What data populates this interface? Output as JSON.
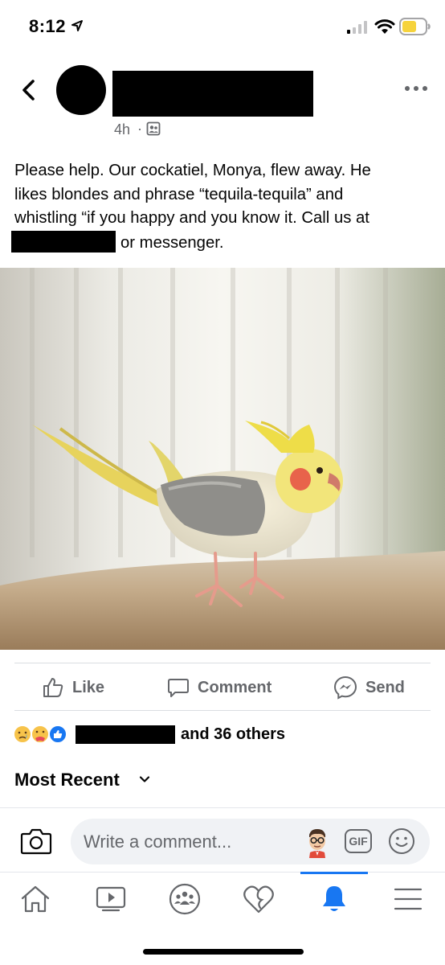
{
  "status_bar": {
    "time": "8:12"
  },
  "post": {
    "time_ago": "4h",
    "separator": "·",
    "text_lines": [
      "Please help. Our cockatiel, Monya, flew away. He",
      "likes blondes and phrase “tequila-tequila” and",
      "whistling “if you happy and you know it. Call us at"
    ],
    "text_last_line_suffix": "or messenger."
  },
  "actions": {
    "like": "Like",
    "comment": "Comment",
    "send": "Send"
  },
  "reactions": {
    "others_text": "and 36 others"
  },
  "comments": {
    "sort_label": "Most Recent",
    "composer_placeholder": "Write a comment...",
    "gif_label": "GIF"
  },
  "colors": {
    "brand_blue": "#1877f2",
    "secondary_text": "#65676b",
    "divider": "#dadde1",
    "input_bg": "#f0f2f5"
  },
  "icons": {
    "header": [
      "back-icon",
      "more-icon",
      "audience-icon"
    ],
    "actions": [
      "like-icon",
      "comment-icon",
      "messenger-icon"
    ],
    "composer": [
      "camera-icon",
      "avatar-sticker-icon",
      "gif-icon",
      "emoji-icon"
    ],
    "tabs": [
      "home-icon",
      "watch-icon",
      "groups-icon",
      "dating-icon",
      "notifications-icon",
      "menu-icon"
    ]
  }
}
